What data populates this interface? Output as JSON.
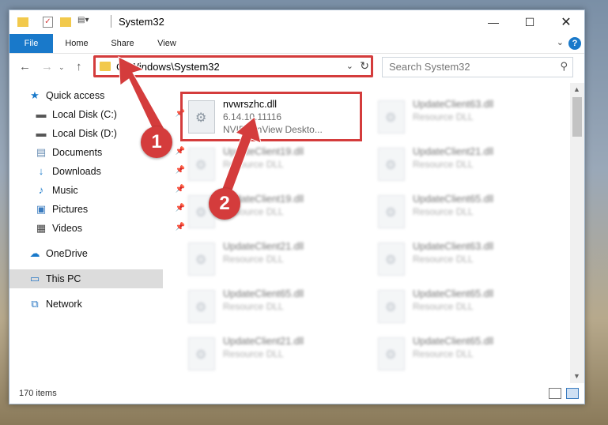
{
  "window": {
    "title": "System32"
  },
  "ribbon": {
    "tabs": [
      "File",
      "Home",
      "Share",
      "View"
    ],
    "help": "?"
  },
  "address": {
    "path": "C:\\Windows\\System32"
  },
  "search": {
    "placeholder": "Search System32"
  },
  "sidebar": {
    "items": [
      {
        "label": "Quick access",
        "icon": "star-icon",
        "pinned": false
      },
      {
        "label": "Local Disk (C:)",
        "icon": "drive-icon",
        "pinned": true
      },
      {
        "label": "Local Disk (D:)",
        "icon": "drive-icon",
        "pinned": false
      },
      {
        "label": "Documents",
        "icon": "document-icon",
        "pinned": true
      },
      {
        "label": "Downloads",
        "icon": "download-icon",
        "pinned": true
      },
      {
        "label": "Music",
        "icon": "music-icon",
        "pinned": true
      },
      {
        "label": "Pictures",
        "icon": "picture-icon",
        "pinned": true
      },
      {
        "label": "Videos",
        "icon": "video-icon",
        "pinned": true
      },
      {
        "label": "OneDrive",
        "icon": "cloud-icon",
        "pinned": false
      },
      {
        "label": "This PC",
        "icon": "computer-icon",
        "pinned": false
      },
      {
        "label": "Network",
        "icon": "network-icon",
        "pinned": false
      }
    ]
  },
  "files": {
    "highlighted": {
      "name": "nvwrszhc.dll",
      "version": "6.14.10.11116",
      "description": "NVIDIA nView Deskto..."
    },
    "col1": [
      {
        "name": "UpdateClient19.dll",
        "type": "Resource DLL"
      },
      {
        "name": "UpdateClient19.dll",
        "type": "Resource DLL"
      },
      {
        "name": "UpdateClient21.dll",
        "type": "Resource DLL"
      },
      {
        "name": "UpdateClient65.dll",
        "type": "Resource DLL"
      },
      {
        "name": "UpdateClient21.dll",
        "type": "Resource DLL"
      }
    ],
    "col2": [
      {
        "name": "UpdateClient63.dll",
        "type": "Resource DLL"
      },
      {
        "name": "UpdateClient21.dll",
        "type": "Resource DLL"
      },
      {
        "name": "UpdateClient65.dll",
        "type": "Resource DLL"
      },
      {
        "name": "UpdateClient63.dll",
        "type": "Resource DLL"
      },
      {
        "name": "UpdateClient65.dll",
        "type": "Resource DLL"
      },
      {
        "name": "UpdateClient65.dll",
        "type": "Resource DLL"
      }
    ]
  },
  "status": {
    "count": "170 items"
  },
  "annotations": {
    "step1": "1",
    "step2": "2",
    "color": "#d43c3c"
  }
}
